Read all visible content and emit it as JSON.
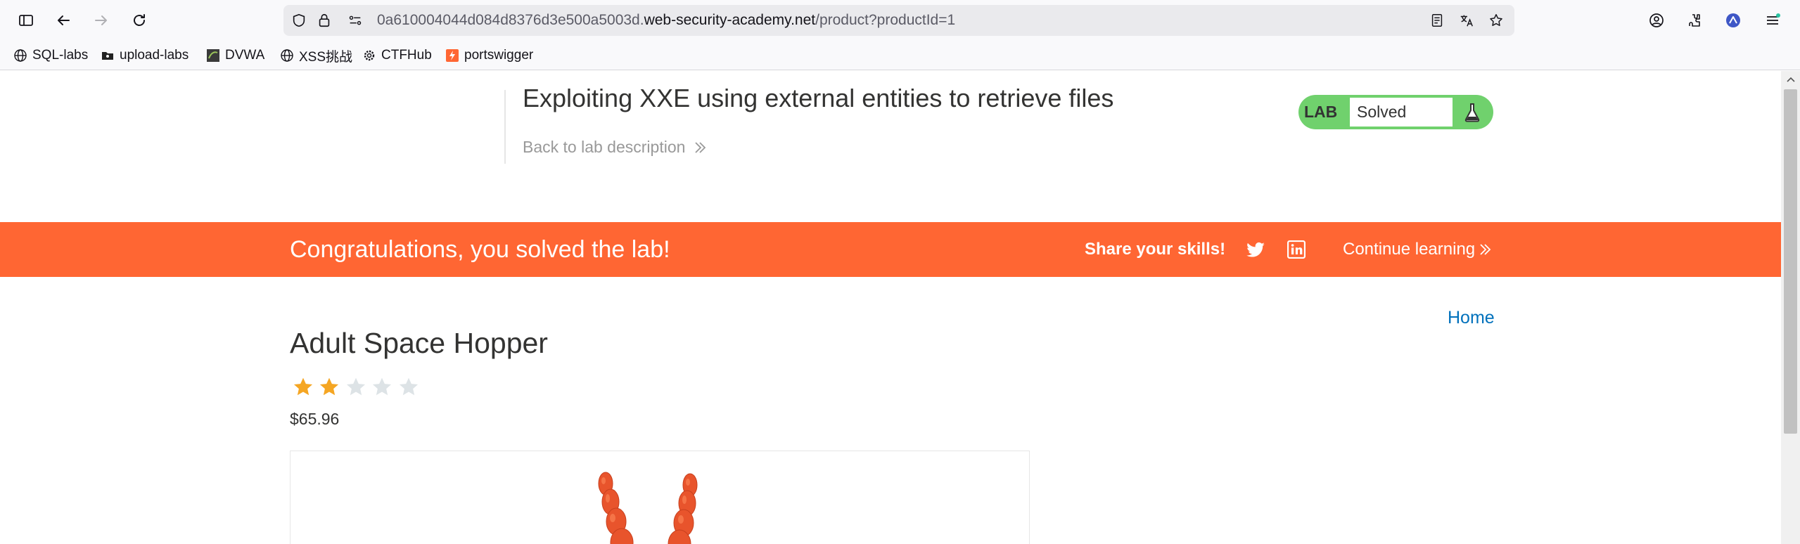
{
  "browser": {
    "url_prefix": "0a610004044d084d8376d3e500a5003d.",
    "url_domain": "web-security-academy.net",
    "url_path": "/product?productId=1",
    "bookmarks": [
      {
        "label": "SQL-labs",
        "icon": "globe-icon"
      },
      {
        "label": "upload-labs",
        "icon": "folder-icon"
      },
      {
        "label": "DVWA",
        "icon": "dvwa-icon"
      },
      {
        "label": "XSS挑战",
        "icon": "globe-icon"
      },
      {
        "label": "CTFHub",
        "icon": "gear-icon"
      },
      {
        "label": "portswigger",
        "icon": "portswigger-icon"
      }
    ]
  },
  "lab": {
    "title": "Exploiting XXE using external entities to retrieve files",
    "back_label": "Back to lab description",
    "status_word": "LAB",
    "status": "Solved",
    "status_color": "#70d16d"
  },
  "banner": {
    "message": "Congratulations, you solved the lab!",
    "share_label": "Share your skills!",
    "continue_label": "Continue learning",
    "color": "#ff6633"
  },
  "product": {
    "home_label": "Home",
    "name": "Adult Space Hopper",
    "rating": 2,
    "rating_max": 5,
    "price": "$65.96"
  }
}
